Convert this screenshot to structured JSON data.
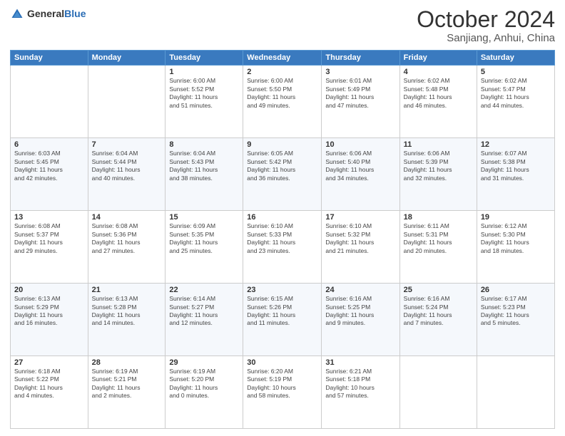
{
  "header": {
    "logo_general": "General",
    "logo_blue": "Blue",
    "month": "October 2024",
    "location": "Sanjiang, Anhui, China"
  },
  "days_of_week": [
    "Sunday",
    "Monday",
    "Tuesday",
    "Wednesday",
    "Thursday",
    "Friday",
    "Saturday"
  ],
  "weeks": [
    [
      {
        "day": "",
        "detail": ""
      },
      {
        "day": "",
        "detail": ""
      },
      {
        "day": "1",
        "detail": "Sunrise: 6:00 AM\nSunset: 5:52 PM\nDaylight: 11 hours\nand 51 minutes."
      },
      {
        "day": "2",
        "detail": "Sunrise: 6:00 AM\nSunset: 5:50 PM\nDaylight: 11 hours\nand 49 minutes."
      },
      {
        "day": "3",
        "detail": "Sunrise: 6:01 AM\nSunset: 5:49 PM\nDaylight: 11 hours\nand 47 minutes."
      },
      {
        "day": "4",
        "detail": "Sunrise: 6:02 AM\nSunset: 5:48 PM\nDaylight: 11 hours\nand 46 minutes."
      },
      {
        "day": "5",
        "detail": "Sunrise: 6:02 AM\nSunset: 5:47 PM\nDaylight: 11 hours\nand 44 minutes."
      }
    ],
    [
      {
        "day": "6",
        "detail": "Sunrise: 6:03 AM\nSunset: 5:45 PM\nDaylight: 11 hours\nand 42 minutes."
      },
      {
        "day": "7",
        "detail": "Sunrise: 6:04 AM\nSunset: 5:44 PM\nDaylight: 11 hours\nand 40 minutes."
      },
      {
        "day": "8",
        "detail": "Sunrise: 6:04 AM\nSunset: 5:43 PM\nDaylight: 11 hours\nand 38 minutes."
      },
      {
        "day": "9",
        "detail": "Sunrise: 6:05 AM\nSunset: 5:42 PM\nDaylight: 11 hours\nand 36 minutes."
      },
      {
        "day": "10",
        "detail": "Sunrise: 6:06 AM\nSunset: 5:40 PM\nDaylight: 11 hours\nand 34 minutes."
      },
      {
        "day": "11",
        "detail": "Sunrise: 6:06 AM\nSunset: 5:39 PM\nDaylight: 11 hours\nand 32 minutes."
      },
      {
        "day": "12",
        "detail": "Sunrise: 6:07 AM\nSunset: 5:38 PM\nDaylight: 11 hours\nand 31 minutes."
      }
    ],
    [
      {
        "day": "13",
        "detail": "Sunrise: 6:08 AM\nSunset: 5:37 PM\nDaylight: 11 hours\nand 29 minutes."
      },
      {
        "day": "14",
        "detail": "Sunrise: 6:08 AM\nSunset: 5:36 PM\nDaylight: 11 hours\nand 27 minutes."
      },
      {
        "day": "15",
        "detail": "Sunrise: 6:09 AM\nSunset: 5:35 PM\nDaylight: 11 hours\nand 25 minutes."
      },
      {
        "day": "16",
        "detail": "Sunrise: 6:10 AM\nSunset: 5:33 PM\nDaylight: 11 hours\nand 23 minutes."
      },
      {
        "day": "17",
        "detail": "Sunrise: 6:10 AM\nSunset: 5:32 PM\nDaylight: 11 hours\nand 21 minutes."
      },
      {
        "day": "18",
        "detail": "Sunrise: 6:11 AM\nSunset: 5:31 PM\nDaylight: 11 hours\nand 20 minutes."
      },
      {
        "day": "19",
        "detail": "Sunrise: 6:12 AM\nSunset: 5:30 PM\nDaylight: 11 hours\nand 18 minutes."
      }
    ],
    [
      {
        "day": "20",
        "detail": "Sunrise: 6:13 AM\nSunset: 5:29 PM\nDaylight: 11 hours\nand 16 minutes."
      },
      {
        "day": "21",
        "detail": "Sunrise: 6:13 AM\nSunset: 5:28 PM\nDaylight: 11 hours\nand 14 minutes."
      },
      {
        "day": "22",
        "detail": "Sunrise: 6:14 AM\nSunset: 5:27 PM\nDaylight: 11 hours\nand 12 minutes."
      },
      {
        "day": "23",
        "detail": "Sunrise: 6:15 AM\nSunset: 5:26 PM\nDaylight: 11 hours\nand 11 minutes."
      },
      {
        "day": "24",
        "detail": "Sunrise: 6:16 AM\nSunset: 5:25 PM\nDaylight: 11 hours\nand 9 minutes."
      },
      {
        "day": "25",
        "detail": "Sunrise: 6:16 AM\nSunset: 5:24 PM\nDaylight: 11 hours\nand 7 minutes."
      },
      {
        "day": "26",
        "detail": "Sunrise: 6:17 AM\nSunset: 5:23 PM\nDaylight: 11 hours\nand 5 minutes."
      }
    ],
    [
      {
        "day": "27",
        "detail": "Sunrise: 6:18 AM\nSunset: 5:22 PM\nDaylight: 11 hours\nand 4 minutes."
      },
      {
        "day": "28",
        "detail": "Sunrise: 6:19 AM\nSunset: 5:21 PM\nDaylight: 11 hours\nand 2 minutes."
      },
      {
        "day": "29",
        "detail": "Sunrise: 6:19 AM\nSunset: 5:20 PM\nDaylight: 11 hours\nand 0 minutes."
      },
      {
        "day": "30",
        "detail": "Sunrise: 6:20 AM\nSunset: 5:19 PM\nDaylight: 10 hours\nand 58 minutes."
      },
      {
        "day": "31",
        "detail": "Sunrise: 6:21 AM\nSunset: 5:18 PM\nDaylight: 10 hours\nand 57 minutes."
      },
      {
        "day": "",
        "detail": ""
      },
      {
        "day": "",
        "detail": ""
      }
    ]
  ]
}
